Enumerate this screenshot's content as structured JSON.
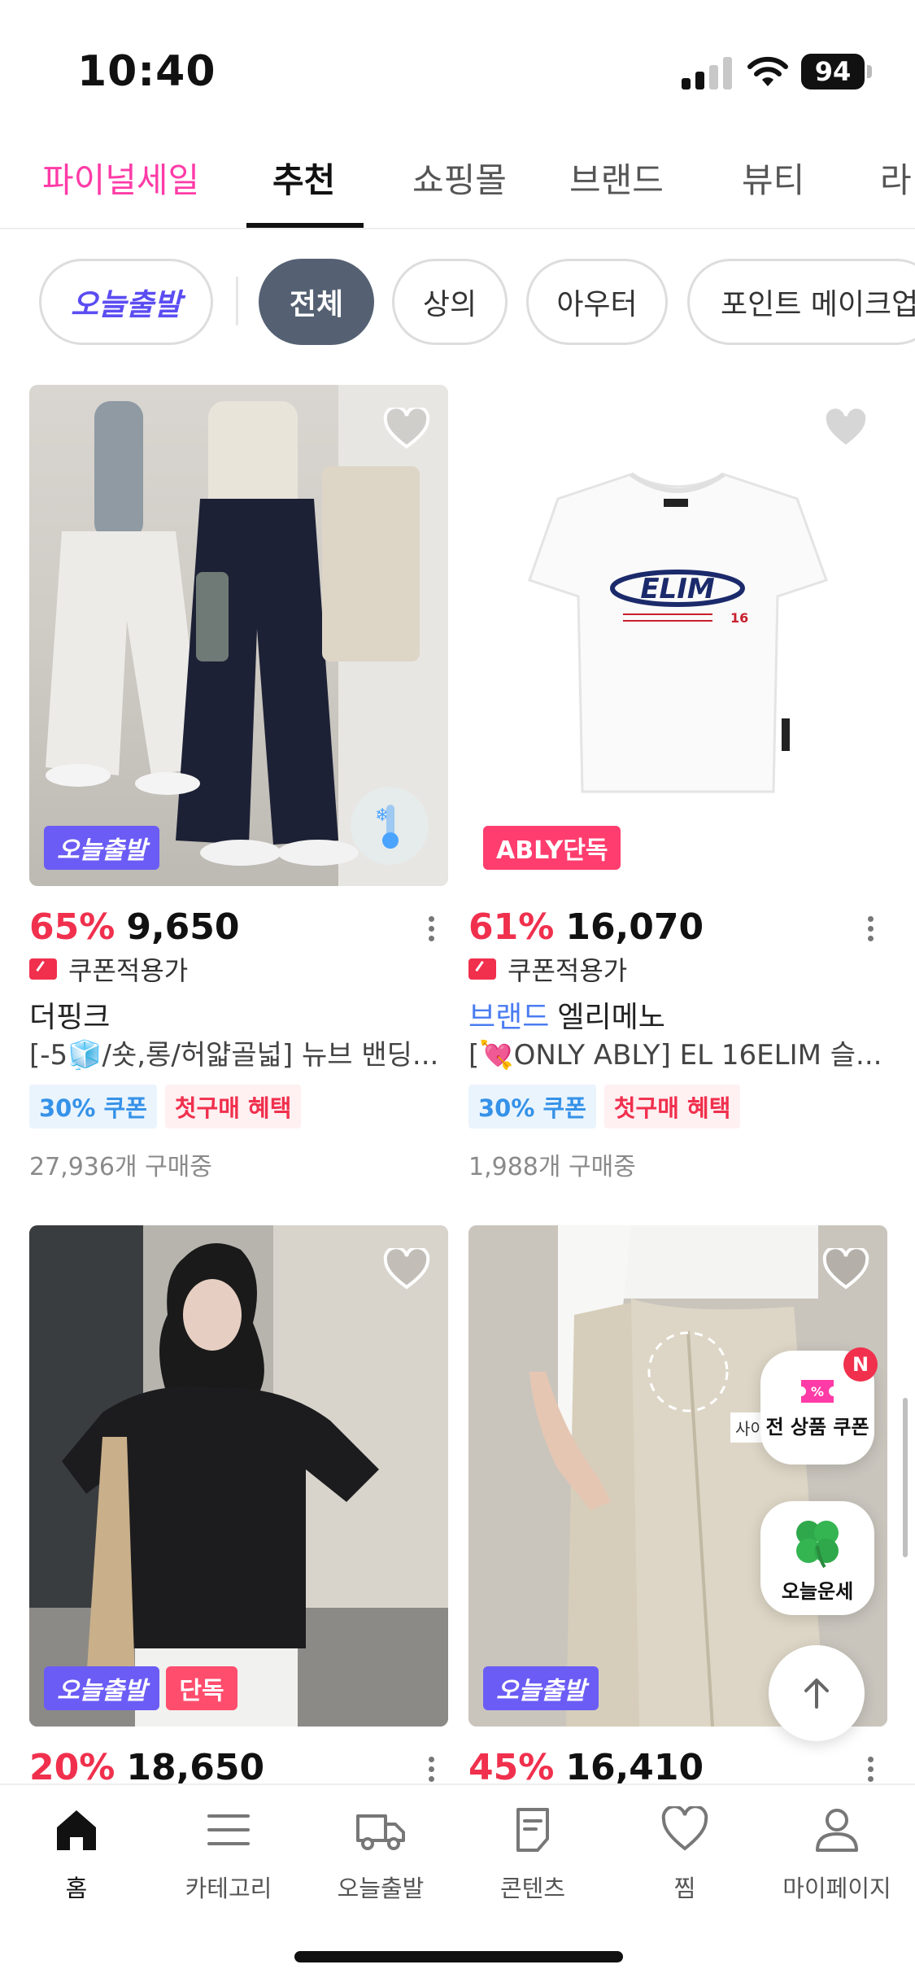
{
  "status_bar": {
    "time": "10:40",
    "battery": "94"
  },
  "top_tabs": [
    {
      "label": "파이널세일"
    },
    {
      "label": "추천"
    },
    {
      "label": "쇼핑몰"
    },
    {
      "label": "브랜드"
    },
    {
      "label": "뷰티"
    },
    {
      "label": "라"
    }
  ],
  "chips": [
    {
      "label": "오늘출발"
    },
    {
      "label": "전체"
    },
    {
      "label": "상의"
    },
    {
      "label": "아우터"
    },
    {
      "label": "포인트 메이크업"
    }
  ],
  "products": [
    {
      "badges": [
        "오늘출발"
      ],
      "discount": "65%",
      "price": "9,650",
      "coupon_label": "쿠폰적용가",
      "brand_tag": "",
      "shop": "더핑크",
      "title": "[-5🧊/숏,롱/허얇골넓] 뉴브 밴딩...",
      "tags": [
        "30% 쿠폰",
        "첫구매 혜택"
      ],
      "sold": "27,936개 구매중"
    },
    {
      "badges": [
        "ABLY단독"
      ],
      "discount": "61%",
      "price": "16,070",
      "coupon_label": "쿠폰적용가",
      "brand_tag": "브랜드",
      "shop": "엘리메노",
      "title": "[💘ONLY ABLY] EL 16ELIM 슬...",
      "tags": [
        "30% 쿠폰",
        "첫구매 혜택"
      ],
      "sold": "1,988개 구매중"
    },
    {
      "badges": [
        "오늘출발",
        "단독"
      ],
      "discount": "20%",
      "price": "18,650"
    },
    {
      "badges": [
        "오늘출발"
      ],
      "discount": "45%",
      "price": "16,410",
      "size_hint": "사이"
    }
  ],
  "tshirt_print": {
    "logo": "ELIM",
    "number": "16"
  },
  "floating": {
    "coupon_label": "전 상품 쿠폰",
    "coupon_badge": "N",
    "fortune_label": "오늘운세"
  },
  "bottom_nav": [
    {
      "label": "홈"
    },
    {
      "label": "카테고리"
    },
    {
      "label": "오늘출발"
    },
    {
      "label": "콘텐츠"
    },
    {
      "label": "찜"
    },
    {
      "label": "마이페이지"
    }
  ],
  "colors": {
    "accent_pink": "#ff3ba7",
    "discount_red": "#f0304d",
    "today_purple": "#6b5cf5",
    "chip_active": "#556173",
    "brand_blue": "#4a7cf2"
  }
}
